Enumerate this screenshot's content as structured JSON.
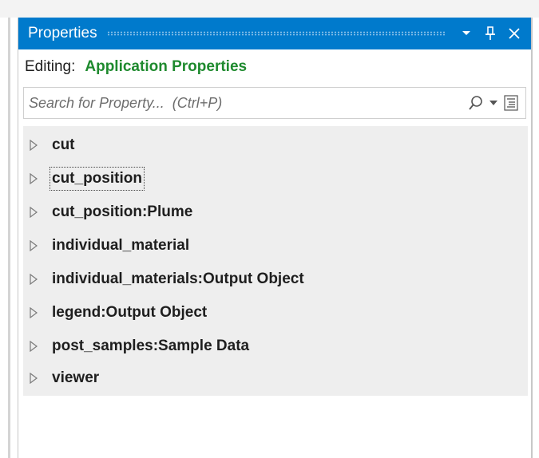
{
  "panel": {
    "title": "Properties",
    "buttons": [
      "chevron-down-icon",
      "pin-icon",
      "close-icon"
    ],
    "accent_color": "#007acc"
  },
  "editing": {
    "label": "Editing:",
    "target": "Application Properties",
    "target_color": "#1e8a2e"
  },
  "search": {
    "placeholder": "Search for Property...  (Ctrl+P)",
    "value": ""
  },
  "properties": [
    {
      "label": "cut",
      "expanded": false,
      "focused": false
    },
    {
      "label": "cut_position",
      "expanded": false,
      "focused": true
    },
    {
      "label": "cut_position:Plume",
      "expanded": false,
      "focused": false
    },
    {
      "label": "individual_material",
      "expanded": false,
      "focused": false
    },
    {
      "label": "individual_materials:Output Object",
      "expanded": false,
      "focused": false
    },
    {
      "label": "legend:Output Object",
      "expanded": false,
      "focused": false
    },
    {
      "label": "post_samples:Sample Data",
      "expanded": false,
      "focused": false
    },
    {
      "label": "viewer",
      "expanded": false,
      "focused": false
    }
  ]
}
